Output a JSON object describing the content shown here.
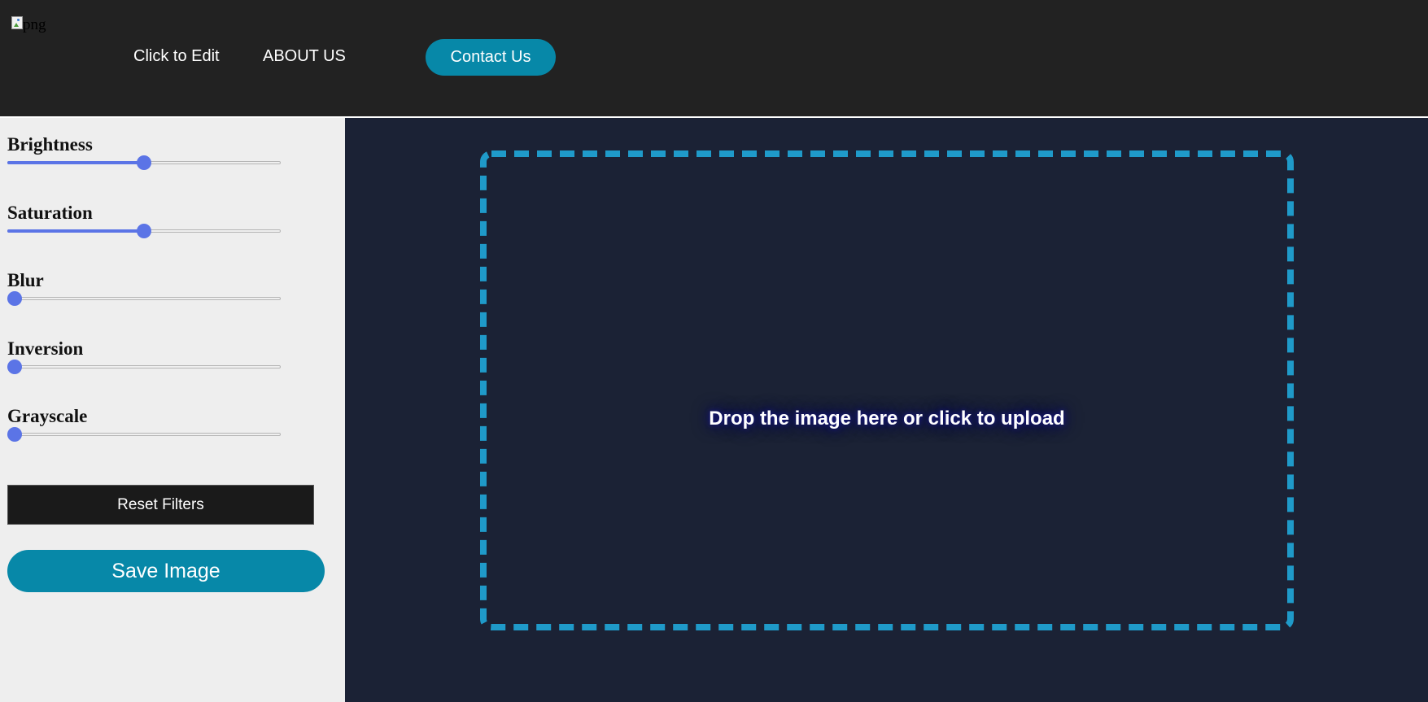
{
  "header": {
    "logo_alt": "png",
    "nav": {
      "edit_label": "Click to Edit",
      "about_label": "ABOUT US",
      "contact_label": "Contact Us"
    }
  },
  "sidebar": {
    "filters": [
      {
        "label": "Brightness",
        "value": 0.5
      },
      {
        "label": "Saturation",
        "value": 0.5
      },
      {
        "label": "Blur",
        "value": 0
      },
      {
        "label": "Inversion",
        "value": 0
      },
      {
        "label": "Grayscale",
        "value": 0
      }
    ],
    "reset_label": "Reset Filters",
    "save_label": "Save Image"
  },
  "main": {
    "drop_text": "Drop the image here or click to upload"
  },
  "colors": {
    "accent": "#0788a8",
    "slider": "#5b74e6",
    "dropzone_border": "#1f9ac9",
    "header_bg": "#222222",
    "main_bg": "#1b2235",
    "sidebar_bg": "#eeeeee"
  }
}
